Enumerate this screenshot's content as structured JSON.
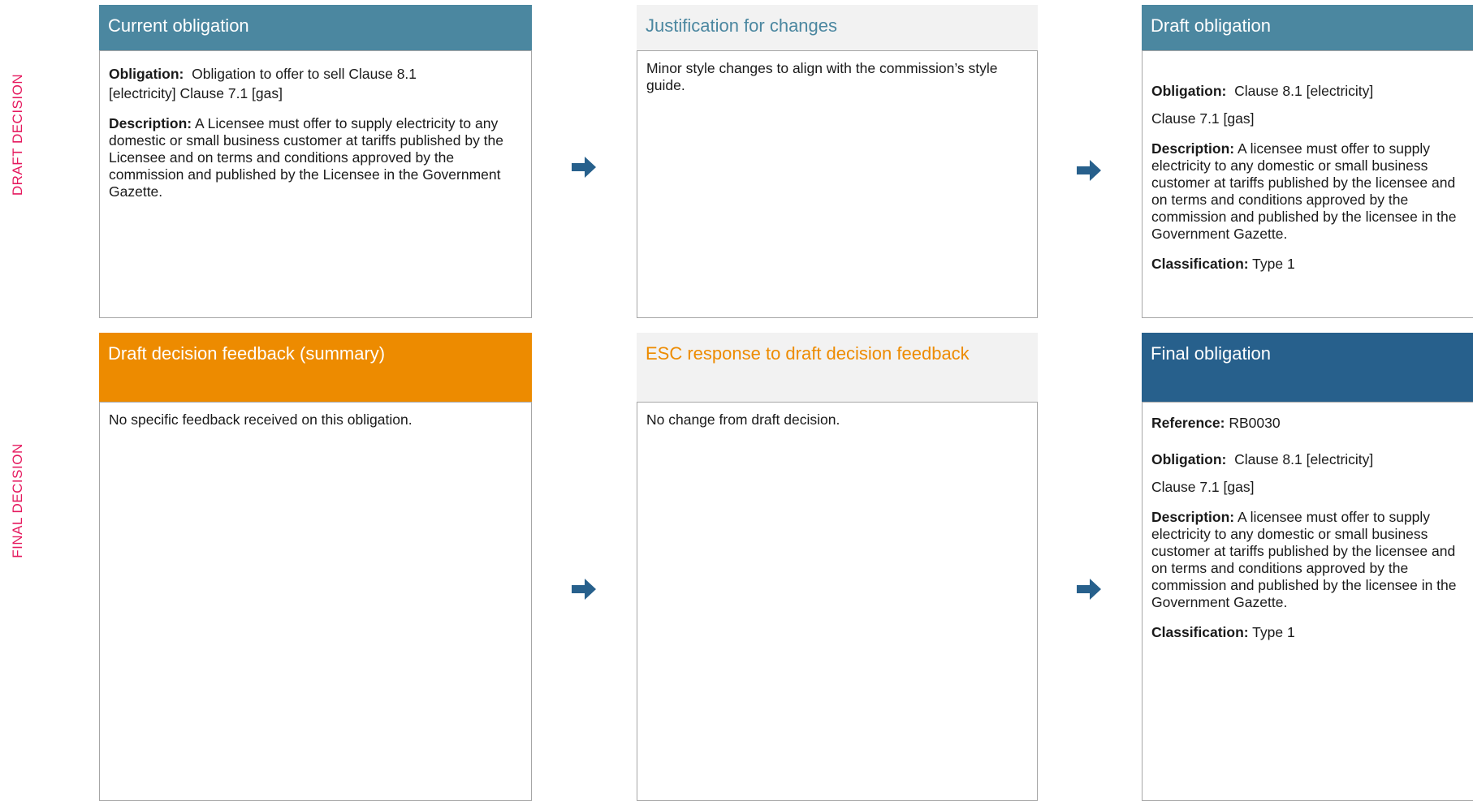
{
  "side_labels": {
    "draft": "DRAFT DECISION",
    "final": "FINAL DECISION"
  },
  "current_obligation": {
    "title": "Current obligation",
    "obligation_label": "Obligation:",
    "obligation_text": "Obligation to offer to sell  Clause 8.1",
    "obligation_text2": "[electricity] Clause 7.1 [gas]",
    "description_label": "Description:",
    "description_text": "A Licensee must offer to supply electricity to any domestic or small business customer at tariffs published by the Licensee and on terms and conditions approved by the commission and published by the Licensee in the Government Gazette."
  },
  "justification": {
    "title": "Justification for changes",
    "text": "Minor style changes to align with the commission’s style guide."
  },
  "draft_obligation": {
    "title": "Draft obligation",
    "obligation_label": "Obligation:",
    "obligation_text": "Clause 8.1 [electricity]",
    "obligation_text2": "Clause 7.1 [gas]",
    "description_label": "Description:",
    "description_text": "A licensee must offer to supply electricity to any domestic or small business customer at tariffs published by the licensee and on terms and conditions approved by the commission and published by the licensee in the Government Gazette.",
    "classification_label": "Classification:",
    "classification_text": "Type 1"
  },
  "feedback": {
    "title": "Draft decision feedback (summary)",
    "text": "No specific feedback received on this obligation."
  },
  "esc_response": {
    "title": "ESC response to draft decision feedback",
    "text": "No change from draft decision."
  },
  "final_obligation": {
    "title": "Final obligation",
    "reference_label": "Reference:",
    "reference_text": "RB0030",
    "obligation_label": "Obligation:",
    "obligation_text": "Clause 8.1 [electricity]",
    "obligation_text2": "Clause 7.1 [gas]",
    "description_label": "Description:",
    "description_text": "A licensee must offer to supply electricity to any domestic or small business customer at tariffs published by the licensee and on terms and conditions approved by the commission and published by the licensee in the Government Gazette.",
    "classification_label": "Classification:",
    "classification_text": "Type 1"
  },
  "icons": {
    "arrow": "arrow-right-icon"
  },
  "colors": {
    "accent_blue": "#4b87a0",
    "navy": "#27608c",
    "orange": "#ed8b00",
    "label_pink": "#e5195e"
  }
}
